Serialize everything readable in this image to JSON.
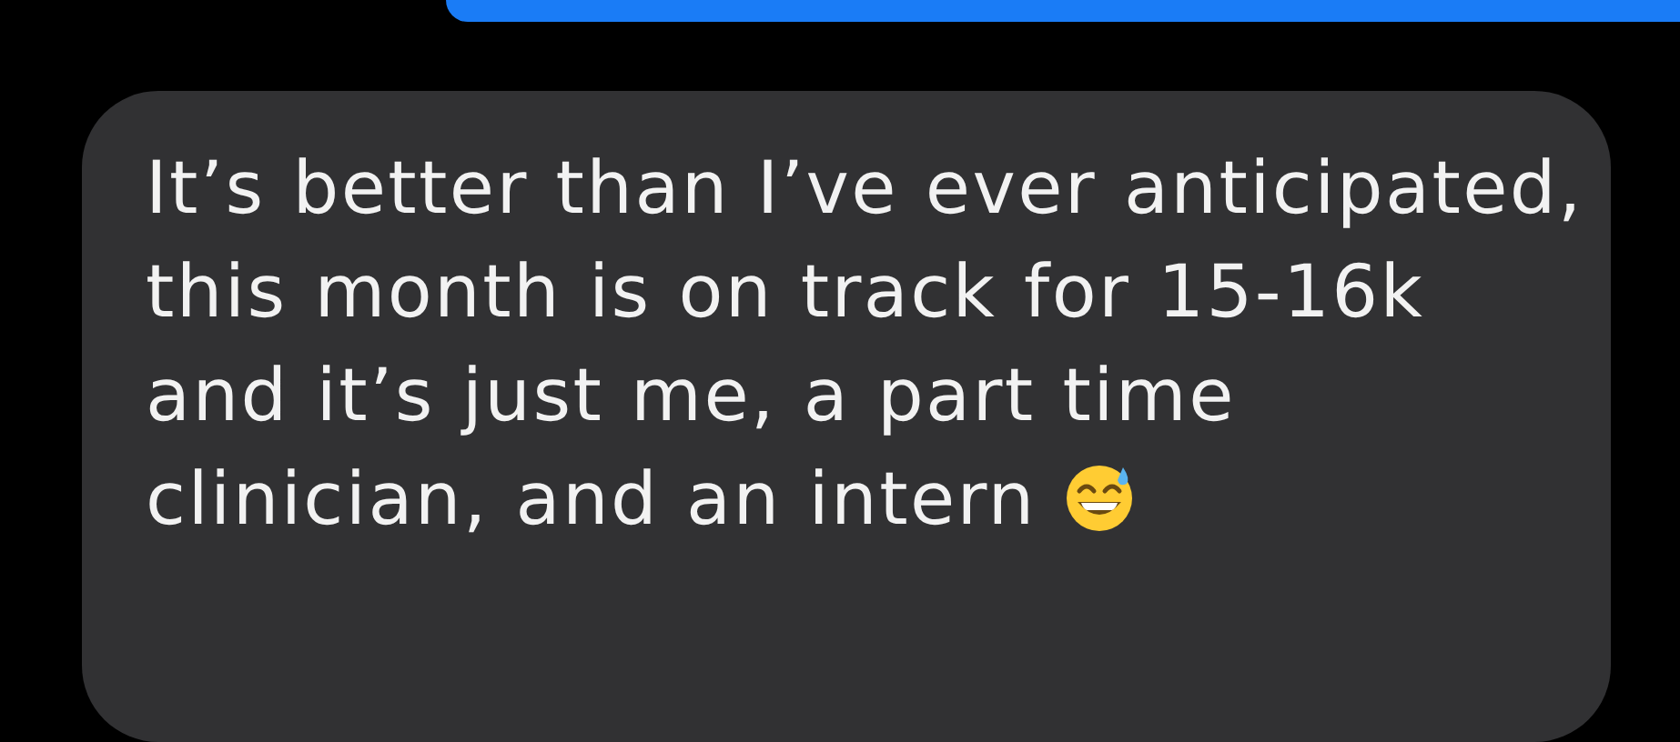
{
  "messages": [
    {
      "kind": "sent"
    },
    {
      "kind": "received",
      "text": "It’s better than I’ve ever anticipated, this month is on track for 15-16k and it’s just me, a part time clinician, and an intern"
    }
  ]
}
